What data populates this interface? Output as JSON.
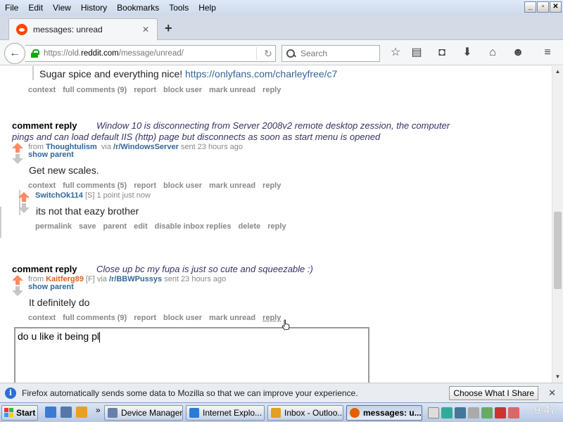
{
  "menubar": {
    "items": [
      {
        "label": "File",
        "key": "F"
      },
      {
        "label": "Edit",
        "key": "E"
      },
      {
        "label": "View",
        "key": "V"
      },
      {
        "label": "History",
        "key": "s"
      },
      {
        "label": "Bookmarks",
        "key": "B"
      },
      {
        "label": "Tools",
        "key": "T"
      },
      {
        "label": "Help",
        "key": "H"
      }
    ],
    "window_buttons": [
      "_",
      "▫",
      "✕"
    ]
  },
  "tab": {
    "title": "messages: unread",
    "close": "✕",
    "new_tab": "+"
  },
  "navbar": {
    "url_prefix": "https://old.",
    "url_domain": "reddit.com",
    "url_suffix": "/message/unread/",
    "search_placeholder": "Search",
    "icons": [
      "star-icon",
      "reading-list-icon",
      "pocket-icon",
      "download-icon",
      "home-icon",
      "smiley-icon",
      "menu-icon"
    ]
  },
  "messages": {
    "first": {
      "quote": "Sugar spice and everything nice!",
      "quote_link": "https://onlyfans.com/charleyfree/c7",
      "buttons": [
        "context",
        "full comments (9)",
        "report",
        "block user",
        "mark unread",
        "reply"
      ]
    },
    "second": {
      "subject": "comment reply",
      "title_line1": "Window 10 is disconnecting from Server 2008v2 remote desktop zession, the computer",
      "title_line2": "pings and can load default IIS (http) page but disconnects as soon as start menu is opened",
      "from": "from",
      "author": "Thoughtulism",
      "via": "via",
      "subreddit": "/r/WindowsServer",
      "time": "sent 23 hours ago",
      "show_parent": "show parent",
      "body": "Get new scales.",
      "buttons": [
        "context",
        "full comments (5)",
        "report",
        "block user",
        "mark unread",
        "reply"
      ]
    },
    "child": {
      "author": "SwitchOk114",
      "flair": "[S]",
      "points": "1 point just now",
      "body": "its not that eazy brother",
      "buttons": [
        "permalink",
        "save",
        "parent",
        "edit",
        "disable inbox replies",
        "delete",
        "reply"
      ]
    },
    "third": {
      "subject": "comment reply",
      "title": "Close up bc my fupa is just so cute and squeezable :)",
      "from": "from",
      "author": "Kaitferg89",
      "flair": "[F]",
      "via": "via",
      "subreddit": "/r/BBWPussys",
      "time": "sent 23 hours ago",
      "show_parent": "show parent",
      "body": "It definitely do",
      "buttons": [
        "context",
        "full comments (9)",
        "report",
        "block user",
        "mark unread",
        "reply"
      ]
    },
    "reply_box_value": "do u like it being pl"
  },
  "notification": {
    "text": "Firefox automatically sends some data to Mozilla so that we can improve your experience.",
    "button": "Choose What I Share",
    "close": "✕"
  },
  "taskbar": {
    "start": "Start",
    "chevron": "»",
    "tasks": [
      {
        "label": "Device Manager",
        "color": "#6a7fa8"
      },
      {
        "label": "Internet Explo...",
        "color": "#2a7bd6"
      },
      {
        "label": "Inbox - Outloo...",
        "color": "#e0a020"
      },
      {
        "label": "messages: u...",
        "color": "#e66000"
      }
    ],
    "clock": "9:47"
  },
  "colors": {
    "upvote": "#ff8b60",
    "downvote": "#c6c6c6",
    "link": "#336699",
    "title": "#333366"
  }
}
